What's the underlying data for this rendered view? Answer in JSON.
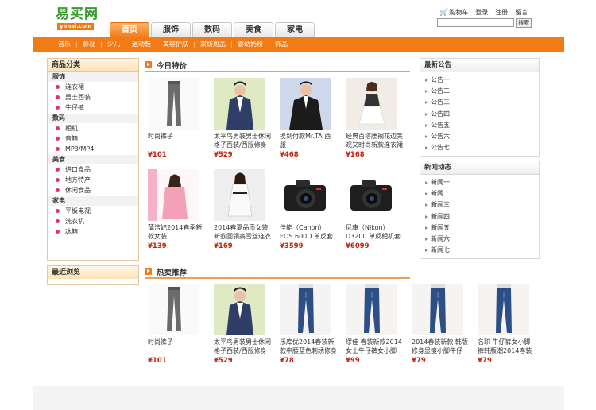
{
  "logo": {
    "cn": "易买网",
    "en": "yimai.com"
  },
  "top_links": {
    "cart": "购物车",
    "login": "登录",
    "register": "注册",
    "message": "留言"
  },
  "search": {
    "button": "搜索",
    "placeholder": ""
  },
  "main_tabs": [
    "首页",
    "服饰",
    "数码",
    "美食",
    "家电"
  ],
  "sub_nav": [
    "音乐",
    "影视",
    "少儿",
    "运动鞋",
    "美容护肤",
    "家纺用品",
    "婴幼奶粉",
    "饰品"
  ],
  "categories": {
    "title": "商品分类",
    "groups": [
      {
        "name": "服饰",
        "items": [
          "连衣裙",
          "男士西装",
          "牛仔裤"
        ]
      },
      {
        "name": "数码",
        "items": [
          "相机",
          "音箱",
          "MP3/MP4"
        ]
      },
      {
        "name": "美食",
        "items": [
          "进口食品",
          "地方特产",
          "休闲食品"
        ]
      },
      {
        "name": "家电",
        "items": [
          "平板电视",
          "洗衣机",
          "冰箱"
        ]
      }
    ]
  },
  "recent": {
    "title": "最近浏览"
  },
  "today_special": {
    "title": "今日特价",
    "products": [
      {
        "name": "时尚裤子",
        "price": "¥101",
        "thumb": "pants-icon"
      },
      {
        "name": "太平鸟男装男士休闲格子西装/西服修身",
        "price": "¥529",
        "thumb": "suit-icon"
      },
      {
        "name": "挨到付款Mr.TA 西服",
        "price": "¥468",
        "thumb": "blazer-icon"
      },
      {
        "name": "经典百搭腰裥花边美观又时尚新款连衣裙",
        "price": "¥168",
        "thumb": "dress-icon"
      },
      {
        "name": "蒲洁妃2014春季新款女装",
        "price": "¥139",
        "thumb": "pink-coat-icon"
      },
      {
        "name": "2014春夏品质女装新款圆领高雪丝连衣",
        "price": "¥169",
        "thumb": "white-dress-icon"
      },
      {
        "name": "佳能（Canon） EOS 600D 单反套机",
        "price": "¥3599",
        "thumb": "camera-icon"
      },
      {
        "name": "尼康（Nikon） D3200 单反相机套机",
        "price": "¥6099",
        "thumb": "camera-icon"
      }
    ]
  },
  "hot_recommend": {
    "title": "热卖推荐",
    "products": [
      {
        "name": "时尚裤子",
        "price": "¥101",
        "thumb": "pants-icon"
      },
      {
        "name": "太平鸟男装男士休闲格子西装/西服修身",
        "price": "¥529",
        "thumb": "suit-icon"
      },
      {
        "name": "乐库优2014春装新款中腰蓝色刺绣修身",
        "price": "¥78",
        "thumb": "jeans-icon"
      },
      {
        "name": "缪佳 春装新款2014女士牛仔裤女小脚",
        "price": "¥99",
        "thumb": "jeans-icon"
      },
      {
        "name": "2014春装新款 韩版修身显瘦小脚牛仔",
        "price": "¥79",
        "thumb": "jeans-icon"
      },
      {
        "name": "名职 牛仔裤女小脚裤韩版潮2014春装",
        "price": "¥79",
        "thumb": "jeans-icon"
      }
    ]
  },
  "announcements": {
    "title": "最新公告",
    "items": [
      "公告一",
      "公告二",
      "公告三",
      "公告四",
      "公告五",
      "公告六",
      "公告七"
    ]
  },
  "news": {
    "title": "新闻动态",
    "items": [
      "新闻一",
      "新闻二",
      "新闻三",
      "新闻四",
      "新闻五",
      "新闻六",
      "新闻七"
    ]
  },
  "colors": {
    "accent": "#f37b16",
    "price": "#c1260d",
    "logo": "#3a9a2f"
  }
}
